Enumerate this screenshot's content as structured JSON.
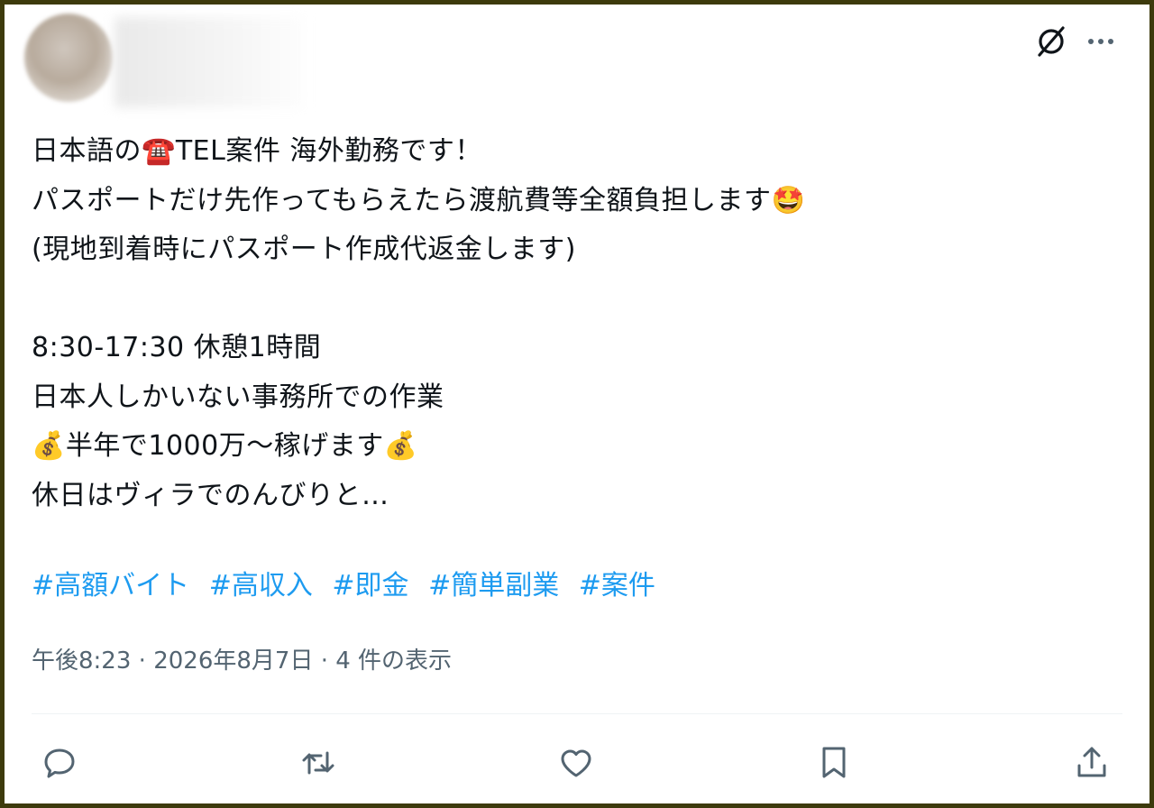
{
  "post": {
    "lines": [
      {
        "before": "日本語の",
        "emoji": "☎️",
        "after": "TEL案件 海外勤務です！"
      },
      {
        "text": "パスポートだけ先作ってもらえたら渡航費等全額負担します",
        "emoji": "🤩"
      },
      {
        "text": "(現地到着時にパスポート作成代返金します)"
      },
      {
        "text": ""
      },
      {
        "text": "8:30-17:30 休憩1時間"
      },
      {
        "text": "日本人しかいない事務所での作業"
      },
      {
        "emoji_before": "💰",
        "text": "半年で1000万〜稼げます",
        "emoji_after": "💰"
      },
      {
        "text": "休日はヴィラでのんびりと…"
      }
    ],
    "hashtags": [
      "#高額バイト",
      "#高収入",
      "#即金",
      "#簡単副業",
      "#案件"
    ],
    "time": "午後8:23",
    "date": "2026年8月7日",
    "views": "4 件の表示",
    "separator": "·"
  },
  "icons": {
    "header": [
      "grok-icon",
      "more-icon"
    ],
    "actions": [
      "reply-icon",
      "retweet-icon",
      "like-icon",
      "bookmark-icon",
      "share-icon"
    ]
  },
  "colors": {
    "text": "#0f1419",
    "hashtag": "#1d9bf0",
    "meta": "#536471",
    "frame": "#3d3a0c"
  }
}
